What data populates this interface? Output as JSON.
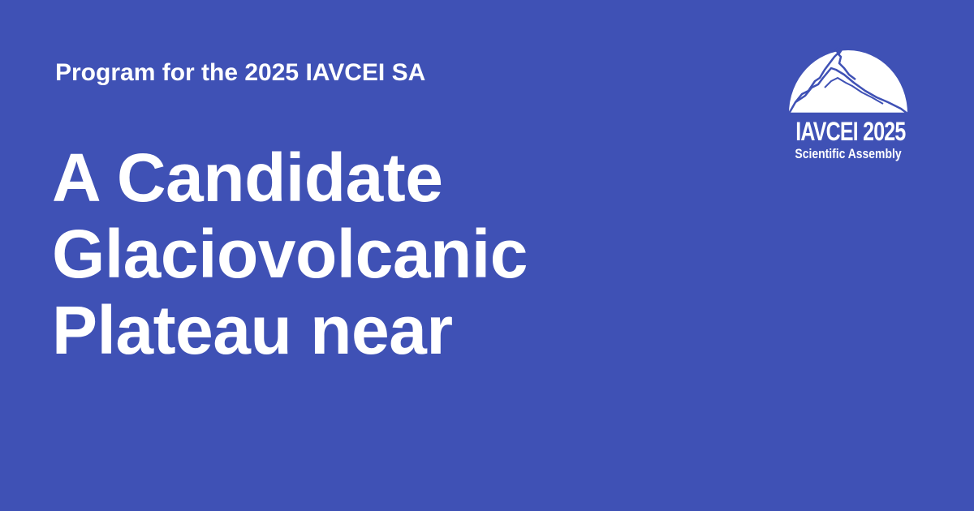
{
  "colors": {
    "background": "#3f51b5",
    "text": "#ffffff"
  },
  "header": {
    "program_title": "Program for the 2025 IAVCEI SA"
  },
  "headline": {
    "lines": [
      "A Candidate",
      "Glaciovolcanic",
      "Plateau near"
    ]
  },
  "logo": {
    "icon": "volcano-mountain-icon",
    "name": "IAVCEI 2025",
    "subtitle": "Scientific Assembly"
  }
}
